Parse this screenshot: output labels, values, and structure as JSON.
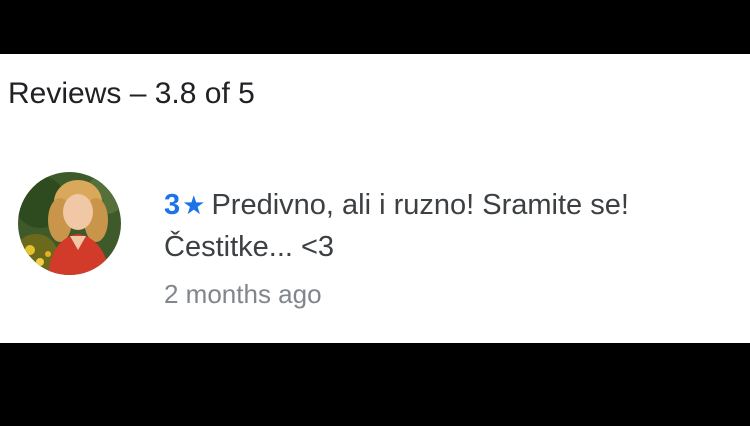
{
  "reviews": {
    "heading": "Reviews – 3.8 of 5",
    "items": [
      {
        "avatar": "user-avatar-photo",
        "rating": "3",
        "star_icon": "★",
        "text_line1": "Predivno, ali i ruzno! Sramite se!",
        "text_line2": "Čestitke... <3",
        "time": "2 months ago"
      }
    ]
  },
  "colors": {
    "accent": "#1a73e8",
    "text": "#3c4043",
    "muted": "#80868b",
    "background": "#ffffff",
    "frame": "#000000"
  }
}
